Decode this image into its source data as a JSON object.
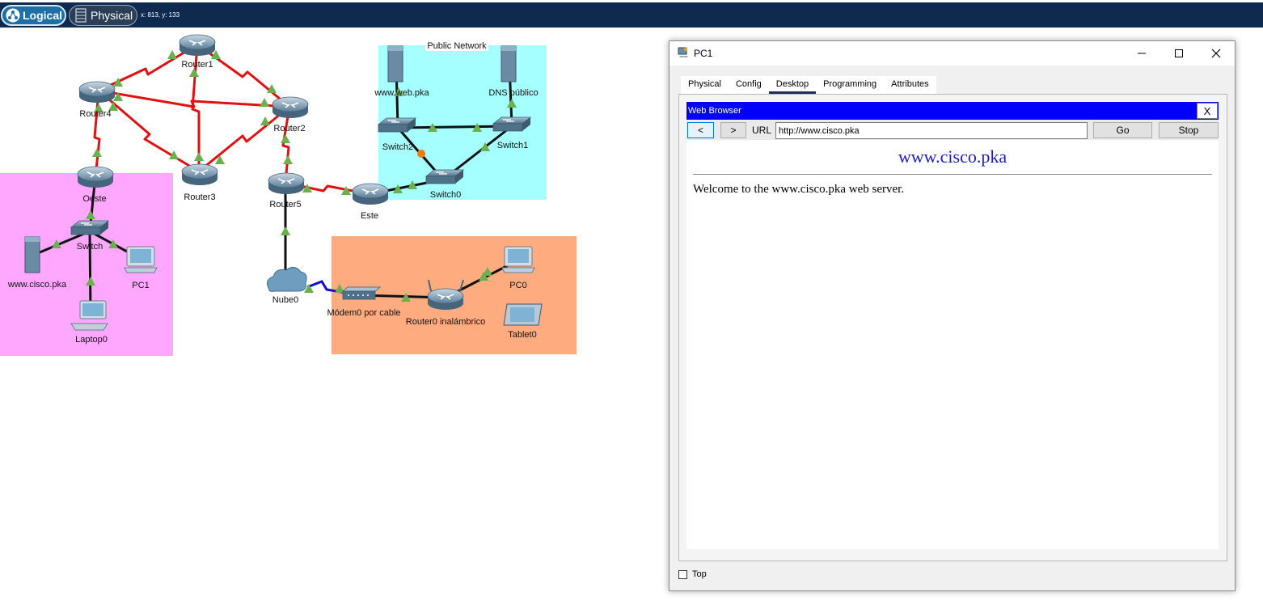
{
  "toolbar": {
    "logical_label": "Logical",
    "physical_label": "Physical",
    "coords": "x: 813, y: 133"
  },
  "topology": {
    "areas": {
      "public_network": "Public Network"
    },
    "devices": {
      "router1": "Router1",
      "router4": "Router4",
      "router2": "Router2",
      "router3": "Router3",
      "router5": "Router5",
      "oeste": "Oeste",
      "este": "Este",
      "switch": "Switch",
      "www_cisco": "www.cisco.pka",
      "pc1": "PC1",
      "laptop0": "Laptop0",
      "nube0": "Nube0",
      "modem": "Módem0 por cable",
      "router0_wireless": "Router0 inalámbrico",
      "pc0": "PC0",
      "tablet0": "Tablet0",
      "www_web": "www.web.pka",
      "dns_publico": "DNS público",
      "switch2": "Switch2",
      "switch1": "Switch1",
      "switch0": "Switch0"
    },
    "colors": {
      "serial_link": "#e41010",
      "ethernet_link": "#111111",
      "coax_link": "#1010d0",
      "link_up": "#6ab04c",
      "link_pending": "#ee7a10",
      "area_magenta": "#ffa6ff",
      "area_cyan": "#a6ffff",
      "area_orange": "#ffab80"
    }
  },
  "window": {
    "title": "PC1",
    "icons": {
      "app": "pc-icon",
      "minimize": "minimize-icon",
      "maximize": "maximize-icon",
      "close": "close-icon"
    },
    "tabs": [
      {
        "label": "Physical"
      },
      {
        "label": "Config"
      },
      {
        "label": "Desktop"
      },
      {
        "label": "Programming"
      },
      {
        "label": "Attributes"
      }
    ],
    "active_tab": "Desktop",
    "browser": {
      "title": "Web Browser",
      "close_label": "X",
      "back_label": "<",
      "forward_label": ">",
      "url_label": "URL",
      "url_value": "http://www.cisco.pka",
      "go_label": "Go",
      "stop_label": "Stop",
      "page_heading": "www.cisco.pka",
      "page_text": "Welcome to the www.cisco.pka web server."
    },
    "top_label": "Top",
    "top_checked": false
  }
}
